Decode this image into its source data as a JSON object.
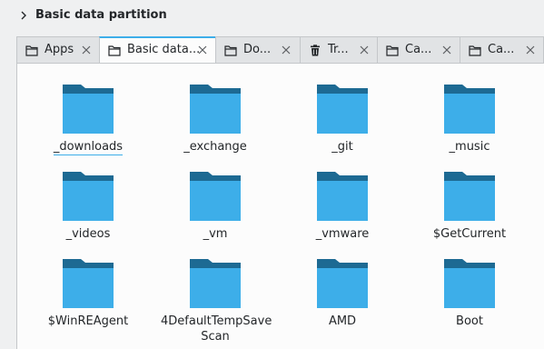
{
  "header": {
    "title": "Basic data partition"
  },
  "tabs": [
    {
      "label": "Apps",
      "icon": "folder-icon",
      "active": false
    },
    {
      "label": "Basic data...",
      "icon": "folder-icon",
      "active": true
    },
    {
      "label": "Do...",
      "icon": "folder-icon",
      "active": false
    },
    {
      "label": "Tr...",
      "icon": "trash-icon",
      "active": false
    },
    {
      "label": "Ca...",
      "icon": "folder-icon",
      "active": false
    },
    {
      "label": "Ca...",
      "icon": "folder-icon",
      "active": false
    }
  ],
  "files": [
    {
      "name": "_downloads"
    },
    {
      "name": "_exchange"
    },
    {
      "name": "_git"
    },
    {
      "name": "_music"
    },
    {
      "name": "_videos"
    },
    {
      "name": "_vm"
    },
    {
      "name": "_vmware"
    },
    {
      "name": "$GetCurrent"
    },
    {
      "name": "$WinREAgent"
    },
    {
      "name": "4DefaultTempSave Scan"
    },
    {
      "name": "AMD"
    },
    {
      "name": "Boot"
    }
  ],
  "colors": {
    "folder_front": "#3daee9",
    "folder_back": "#1d6a93",
    "accent": "#3daee9"
  }
}
